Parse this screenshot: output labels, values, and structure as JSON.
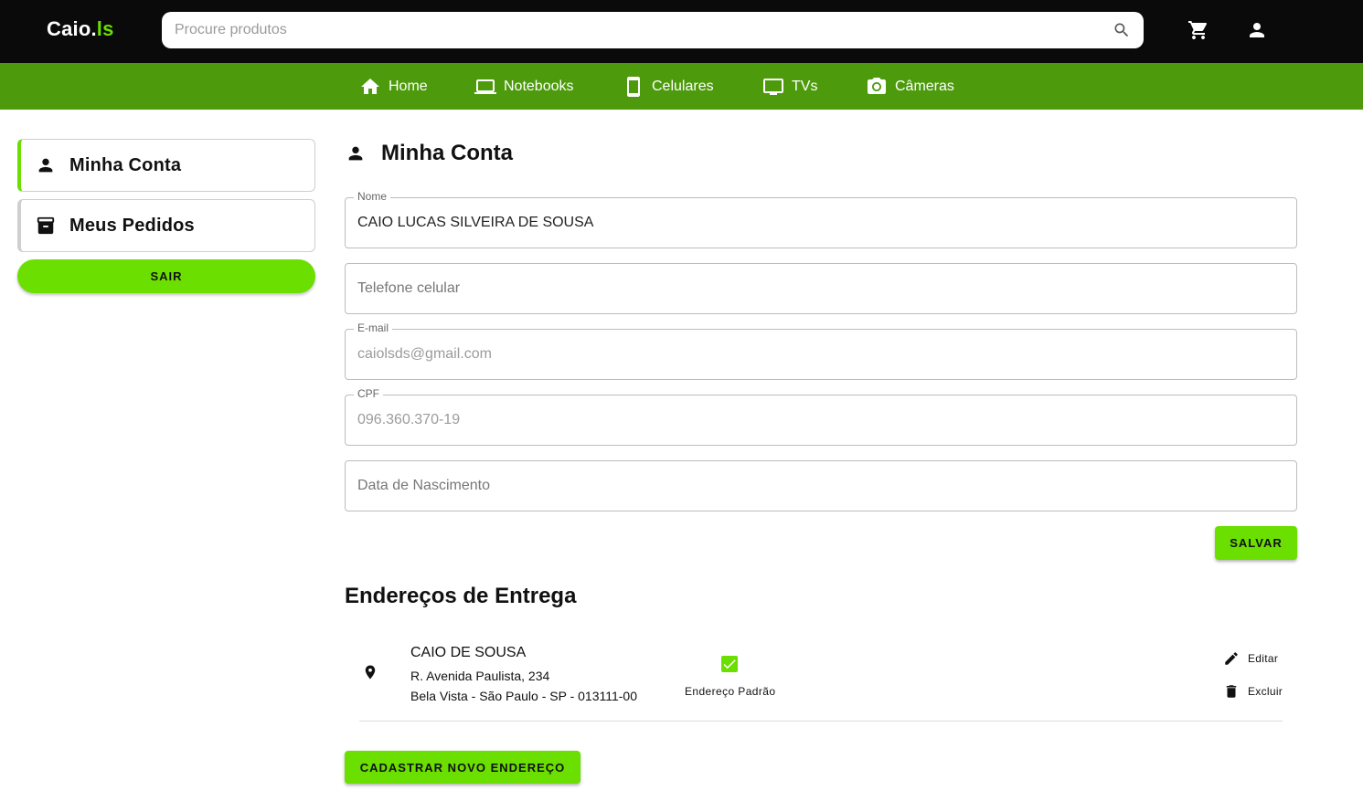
{
  "header": {
    "logo_main": "Caio.",
    "logo_accent": "ls",
    "search_placeholder": "Procure produtos",
    "search_value": ""
  },
  "nav": {
    "items": [
      {
        "label": "Home",
        "icon": "home-icon"
      },
      {
        "label": "Notebooks",
        "icon": "laptop-icon"
      },
      {
        "label": "Celulares",
        "icon": "smartphone-icon"
      },
      {
        "label": "TVs",
        "icon": "tv-icon"
      },
      {
        "label": "Câmeras",
        "icon": "camera-icon"
      }
    ]
  },
  "sidebar": {
    "items": [
      {
        "label": "Minha Conta",
        "icon": "person-icon",
        "active": true
      },
      {
        "label": "Meus Pedidos",
        "icon": "archive-icon",
        "active": false
      }
    ],
    "logout_label": "SAIR"
  },
  "account": {
    "title": "Minha Conta",
    "fields": {
      "name": {
        "label": "Nome",
        "value": "CAIO LUCAS SILVEIRA DE SOUSA"
      },
      "phone": {
        "placeholder": "Telefone celular",
        "value": ""
      },
      "email": {
        "label": "E-mail",
        "value": "caiolsds@gmail.com"
      },
      "cpf": {
        "label": "CPF",
        "value": "096.360.370-19"
      },
      "birthdate": {
        "placeholder": "Data de Nascimento",
        "value": ""
      }
    },
    "save_label": "SALVAR"
  },
  "addresses": {
    "title": "Endereços de Entrega",
    "items": [
      {
        "name": "CAIO DE SOUSA",
        "line1": "R. Avenida Paulista, 234",
        "line2": "Bela Vista - São Paulo - SP - 013111-00",
        "is_default": true,
        "default_label": "Endereço Padrão",
        "edit_label": "Editar",
        "delete_label": "Excluir"
      }
    ],
    "new_address_label": "CADASTRAR NOVO ENDEREÇO"
  },
  "colors": {
    "accent": "#6bdf00",
    "navbar": "#4d9b0c",
    "topbar": "#0a0a0a"
  }
}
